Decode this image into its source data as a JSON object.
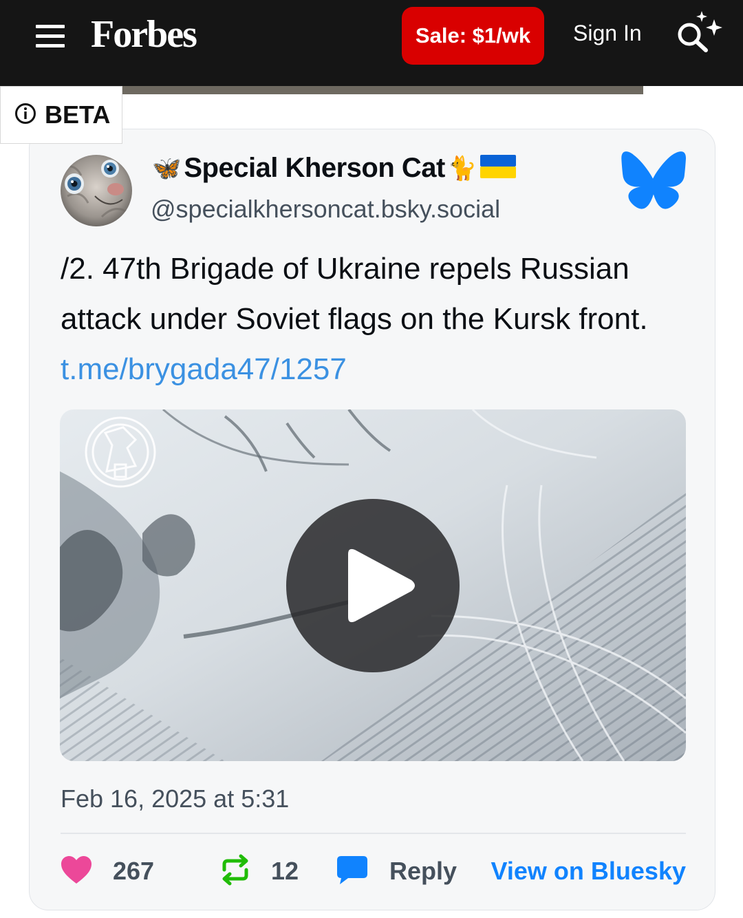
{
  "header": {
    "logo": "Forbes",
    "sale_label": "Sale: $1/wk",
    "signin_label": "Sign In",
    "menu_icon": "hamburger-menu-icon",
    "search_icon": "ai-search-icon"
  },
  "beta": {
    "label": "BETA",
    "icon": "info-icon"
  },
  "post": {
    "display_name": "Special Kherson Cat",
    "name_prefix_emoji": "🦋",
    "name_suffix_emoji": "🐈",
    "name_flag": "ukraine-flag",
    "handle": "@specialkhersoncat.bsky.social",
    "text": "/2. 47th Brigade of Ukraine repels Russian attack under Soviet flags on the Kursk front.",
    "link": "t.me/brygada47/1257",
    "timestamp": "Feb 16, 2025 at 5:31",
    "likes": "267",
    "reposts": "12",
    "reply_label": "Reply",
    "view_label": "View on Bluesky"
  },
  "colors": {
    "header_bg": "#151515",
    "sale_red": "#d90000",
    "link_blue": "#3b91e2",
    "bluesky_blue": "#1083fe",
    "like_pink": "#ec4899",
    "repost_green": "#20bc07"
  }
}
